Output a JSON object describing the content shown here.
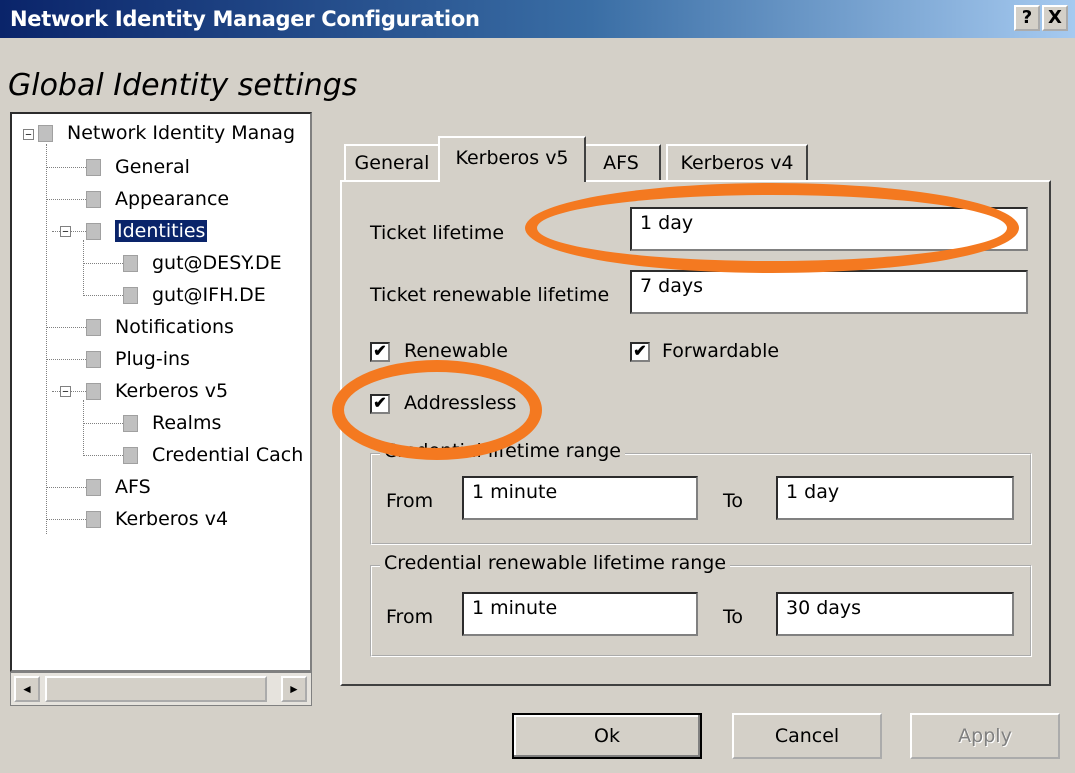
{
  "window": {
    "title": "Network Identity Manager Configuration",
    "help_glyph": "?",
    "close_glyph": "X"
  },
  "heading": "Global Identity settings",
  "tree": {
    "items": [
      {
        "label": "Network Identity Manag",
        "level": 0,
        "expander": "⊟"
      },
      {
        "label": "General",
        "level": 1
      },
      {
        "label": "Appearance",
        "level": 1
      },
      {
        "label": "Identities",
        "level": 1,
        "expander": "⊟",
        "selected": true
      },
      {
        "label": "gut@DESY.DE",
        "level": 2
      },
      {
        "label": "gut@IFH.DE",
        "level": 2
      },
      {
        "label": "Notifications",
        "level": 1
      },
      {
        "label": "Plug-ins",
        "level": 1
      },
      {
        "label": "Kerberos v5",
        "level": 1,
        "expander": "⊟"
      },
      {
        "label": "Realms",
        "level": 2
      },
      {
        "label": "Credential Cach",
        "level": 2
      },
      {
        "label": "AFS",
        "level": 1
      },
      {
        "label": "Kerberos v4",
        "level": 1
      }
    ],
    "scroll_left": "◄",
    "scroll_right": "►"
  },
  "tabs": [
    {
      "label": "General",
      "active": false
    },
    {
      "label": "Kerberos v5",
      "active": true
    },
    {
      "label": "AFS",
      "active": false
    },
    {
      "label": "Kerberos v4",
      "active": false
    }
  ],
  "form": {
    "ticket_lifetime_label": "Ticket lifetime",
    "ticket_lifetime_value": "1 day",
    "ticket_renewable_label": "Ticket renewable lifetime",
    "ticket_renewable_value": "7 days",
    "renewable_label": "Renewable",
    "renewable_checked": true,
    "forwardable_label": "Forwardable",
    "forwardable_checked": true,
    "addressless_label": "Addressless",
    "addressless_checked": true,
    "credential_range": {
      "legend": "Credential lifetime range",
      "from_label": "From",
      "from_value": "1 minute",
      "to_label": "To",
      "to_value": "1 day"
    },
    "renewable_range": {
      "legend": "Credential renewable lifetime range",
      "from_label": "From",
      "from_value": "1 minute",
      "to_label": "To",
      "to_value": "30 days"
    }
  },
  "buttons": {
    "ok": "Ok",
    "cancel": "Cancel",
    "apply": "Apply"
  },
  "check_glyph": "✔",
  "colors": {
    "highlight": "#f47920",
    "selection": "#0a246a"
  }
}
